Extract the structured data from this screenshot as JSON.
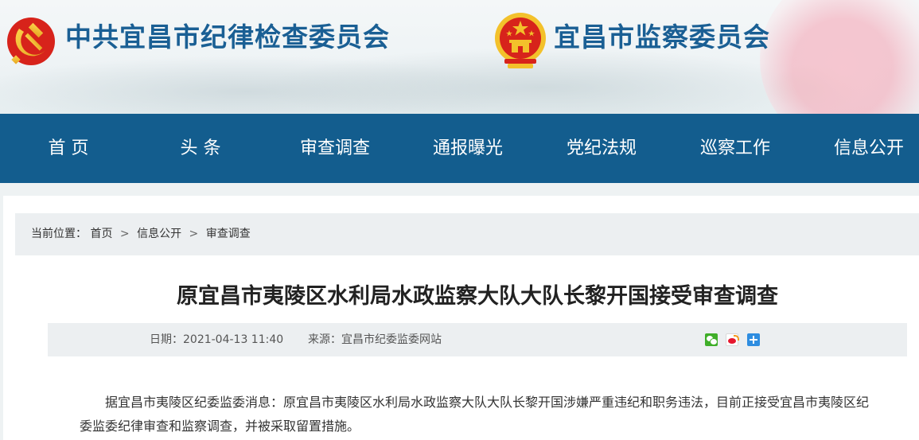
{
  "header": {
    "left_title": "中共宜昌市纪律检查委员会",
    "right_title": "宜昌市监察委员会",
    "party_emblem_icon": "party-emblem",
    "national_emblem_icon": "national-emblem"
  },
  "nav": {
    "items": [
      {
        "label": "首 页"
      },
      {
        "label": "头 条"
      },
      {
        "label": "审查调查"
      },
      {
        "label": "通报曝光"
      },
      {
        "label": "党纪法规"
      },
      {
        "label": "巡察工作"
      },
      {
        "label": "信息公开"
      }
    ]
  },
  "breadcrumb": {
    "prefix": "当前位置：",
    "items": [
      "首页",
      "信息公开",
      "审查调查"
    ],
    "separator": ">"
  },
  "article": {
    "title": "原宜昌市夷陵区水利局水政监察大队大队长黎开国接受审查调查",
    "date": "日期：2021-04-13 11:40",
    "source": "来源：宜昌市纪委监委网站",
    "body": "据宜昌市夷陵区纪委监委消息：原宜昌市夷陵区水利局水政监察大队大队长黎开国涉嫌严重违纪和职务违法，目前正接受宜昌市夷陵区纪委监委纪律审查和监察调查，并被采取留置措施。"
  },
  "share": {
    "icons": [
      "wechat-icon",
      "weibo-icon",
      "plus-icon"
    ]
  },
  "colors": {
    "title_blue": "#1a5f94",
    "nav_bg": "#135d8e",
    "party_red": "#d7231b",
    "gold": "#f3c12b"
  }
}
